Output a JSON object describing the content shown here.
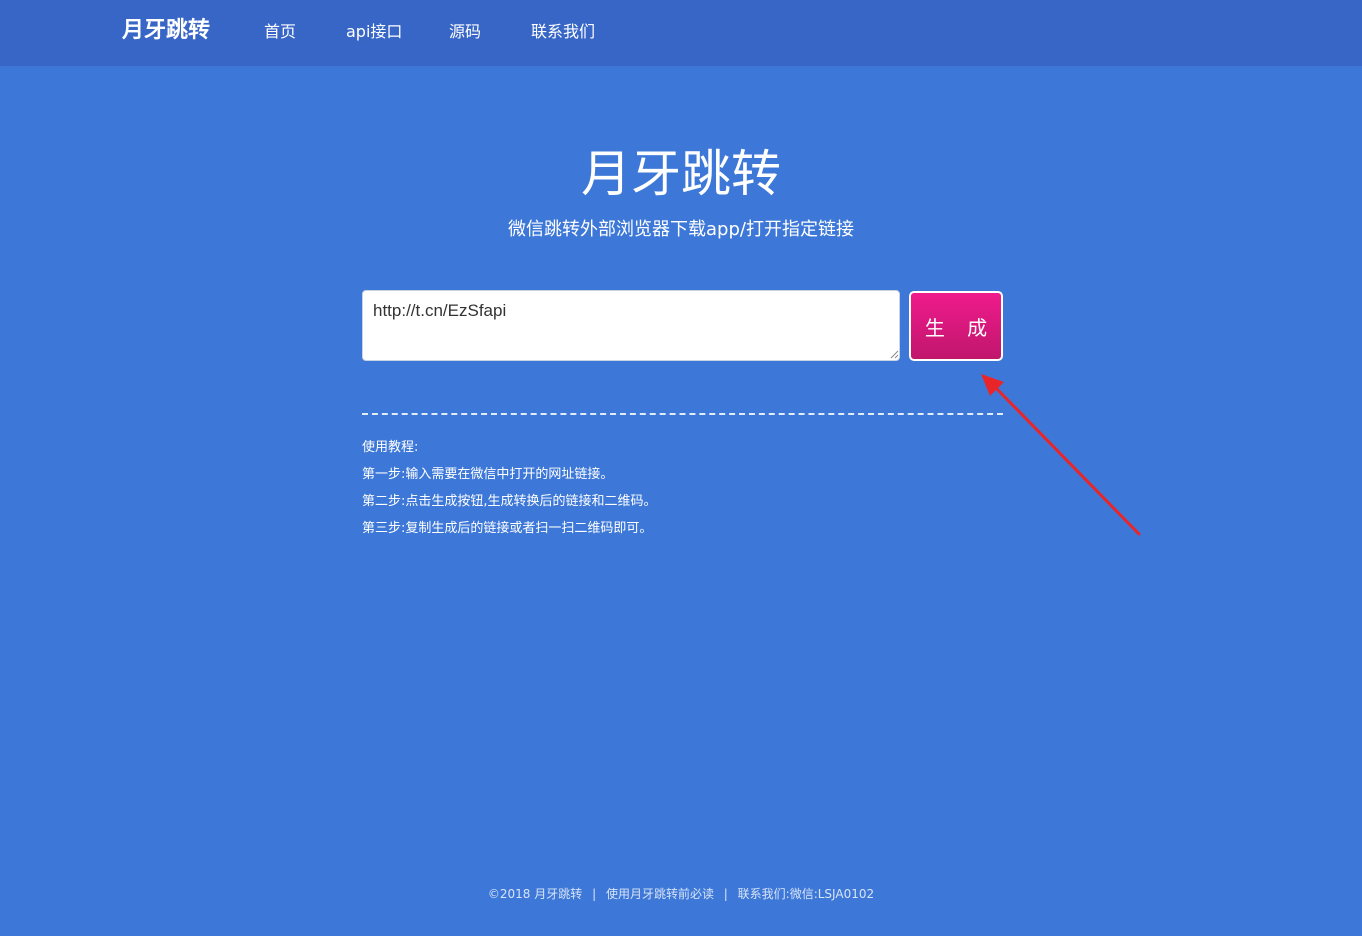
{
  "header": {
    "brand": "月牙跳转",
    "nav": [
      {
        "label": "首页"
      },
      {
        "label": "api接口"
      },
      {
        "label": "源码"
      },
      {
        "label": "联系我们"
      }
    ]
  },
  "hero": {
    "title": "月牙跳转",
    "subtitle": "微信跳转外部浏览器下载app/打开指定链接"
  },
  "form": {
    "url_value": "http://t.cn/EzSfapi",
    "generate_label": "生 成"
  },
  "guide": {
    "heading": "使用教程:",
    "steps": [
      "第一步:输入需要在微信中打开的网址链接。",
      "第二步:点击生成按钮,生成转换后的链接和二维码。",
      "第三步:复制生成后的链接或者扫一扫二维码即可。"
    ]
  },
  "footer": {
    "copyright": "©2018 月牙跳转",
    "sep1": "|",
    "notice": "使用月牙跳转前必读",
    "sep2": "|",
    "contact": "联系我们:微信:LSJA0102"
  },
  "colors": {
    "background": "#3d78d8",
    "topbar": "#3766c7",
    "button": "#e0197f",
    "arrow": "#e8262a"
  },
  "icons": {
    "arrow": "red-arrow-icon",
    "grip": "resize-grip-icon"
  }
}
